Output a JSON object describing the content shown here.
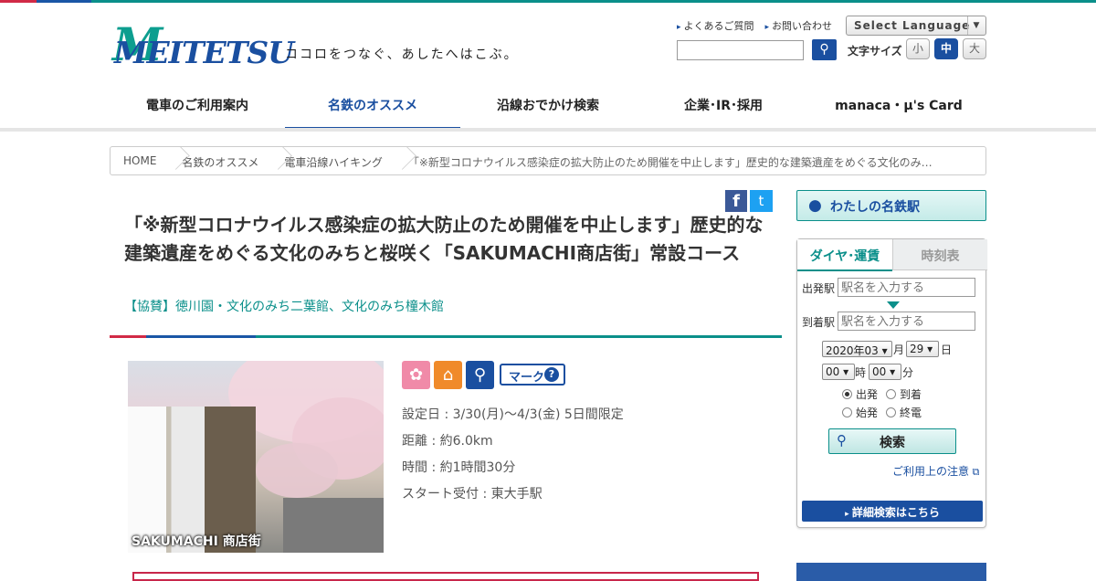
{
  "header": {
    "logo_text": "MEITETSU",
    "tagline": "ココロをつなぐ、あしたへはこぶ。",
    "links": [
      "よくあるご質問",
      "お問い合わせ"
    ],
    "language_select": "Select Language",
    "font_size_label": "文字サイズ",
    "font_sizes": [
      "小",
      "中",
      "大"
    ],
    "search_placeholder": ""
  },
  "nav": {
    "items": [
      "電車のご利用案内",
      "名鉄のオススメ",
      "沿線おでかけ検索",
      "企業･IR･採用",
      "manaca・μ's Card"
    ],
    "active_index": 1
  },
  "breadcrumb": [
    "HOME",
    "名鉄のオススメ",
    "電車沿線ハイキング",
    "「※新型コロナウイルス感染症の拡大防止のため開催を中止します」歴史的な建築遺産をめぐる文化のみ…"
  ],
  "article": {
    "title": "「※新型コロナウイルス感染症の拡大防止のため開催を中止します」歴史的な建築遺産をめぐる文化のみちと桜咲く「SAKUMACHI商店街」常設コース",
    "sponsor": "【協賛】徳川園・文化のみち二葉館、文化のみち橦木館",
    "photo_caption": "SAKUMACHI 商店街",
    "mark_label": "マーク",
    "details": [
      "設定日 : 3/30(月)～4/3(金) 5日間限定",
      "距離 : 約6.0km",
      "時間 : 約1時間30分",
      "スタート受付 : 東大手駅"
    ]
  },
  "share": {
    "facebook": "f",
    "twitter": "t"
  },
  "sidebar": {
    "my_station": "わたしの名鉄駅",
    "tabs": [
      "ダイヤ･運賃",
      "時刻表"
    ],
    "from_label": "出発駅",
    "to_label": "到着駅",
    "from_placeholder": "駅名を入力する",
    "to_placeholder": "駅名を入力する",
    "year_month": "2020年03",
    "month_unit": "月",
    "day": "29",
    "day_unit": "日",
    "hour": "00",
    "hour_unit": "時",
    "minute": "00",
    "minute_unit": "分",
    "radios": [
      "出発",
      "到着",
      "始発",
      "終電"
    ],
    "radio_selected": "出発",
    "search_button": "検索",
    "notice_link": "ご利用上の注意",
    "detail_button": "詳細検索はこちら"
  },
  "colors": {
    "brand_blue": "#1a4fa0",
    "brand_teal": "#0a8f8a",
    "brand_red": "#d12a46"
  },
  "icons": [
    "sakura-icon",
    "house-icon",
    "search-icon",
    "help-icon",
    "pin-icon"
  ]
}
